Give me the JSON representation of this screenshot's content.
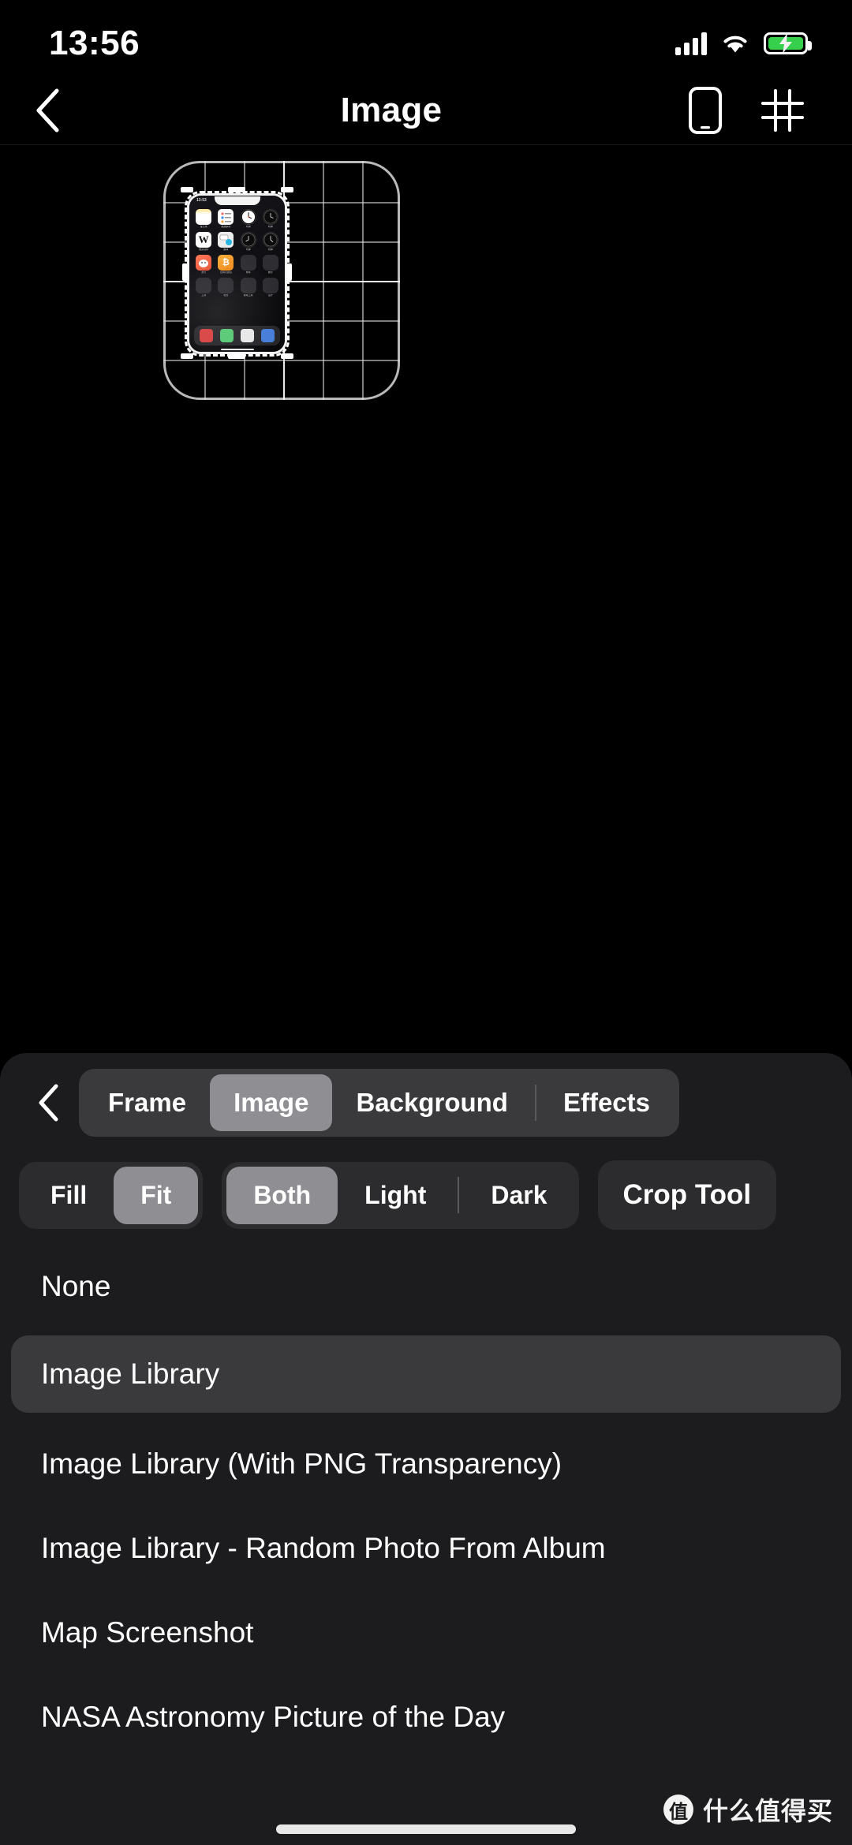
{
  "status_bar": {
    "time": "13:56",
    "cellular_icon": "cellular-signal-icon",
    "wifi_icon": "wifi-icon",
    "battery_icon": "battery-charging-icon",
    "battery_color": "#36d04c"
  },
  "nav_bar": {
    "back_icon": "chevron-left-icon",
    "title": "Image",
    "device_icon": "phone-device-icon",
    "grid_icon": "grid-hash-icon"
  },
  "preview": {
    "frame_label": "device-frame-preview",
    "grid_overlay": true,
    "inner_screenshot_time": "13:53",
    "inner_apps": [
      {
        "label": "备忘录",
        "icon": "notes-icon"
      },
      {
        "label": "提醒事项",
        "icon": "reminders-icon"
      },
      {
        "label": "时钟",
        "icon": "clock-widget-icon"
      },
      {
        "label": "时钟",
        "icon": "clock-widget-icon"
      },
      {
        "label": "维基百科",
        "icon": "wikipedia-icon"
      },
      {
        "label": "翻译",
        "icon": "messages-icon"
      },
      {
        "label": "时钟",
        "icon": "clock-widget-icon"
      },
      {
        "label": "时钟",
        "icon": "clock-widget-icon"
      },
      {
        "label": "支付",
        "icon": "alipay-icon"
      },
      {
        "label": "比特币钱包",
        "icon": "bitcoin-icon"
      },
      {
        "label": "效率",
        "icon": "folder-icon"
      },
      {
        "label": "娱乐",
        "icon": "folder-icon"
      },
      {
        "label": "工具",
        "icon": "folder-icon"
      },
      {
        "label": "社交",
        "icon": "folder-icon"
      },
      {
        "label": "游戏工具",
        "icon": "folder-icon"
      },
      {
        "label": "设计",
        "icon": "folder-icon"
      }
    ]
  },
  "sheet": {
    "back_icon": "chevron-left-icon",
    "tabs": [
      {
        "label": "Frame",
        "active": false
      },
      {
        "label": "Image",
        "active": true
      },
      {
        "label": "Background",
        "active": false
      },
      {
        "label": "Effects",
        "active": false
      }
    ],
    "fit_segment": [
      {
        "label": "Fill",
        "active": false
      },
      {
        "label": "Fit",
        "active": true
      }
    ],
    "appearance_segment": [
      {
        "label": "Both",
        "active": true
      },
      {
        "label": "Light",
        "active": false
      },
      {
        "label": "Dark",
        "active": false
      }
    ],
    "crop_button": "Crop Tool",
    "options": [
      {
        "label": "None",
        "selected": false
      },
      {
        "label": "Image Library",
        "selected": true
      },
      {
        "label": "Image Library (With PNG Transparency)",
        "selected": false
      },
      {
        "label": "Image Library - Random Photo From Album",
        "selected": false
      },
      {
        "label": "Map Screenshot",
        "selected": false
      },
      {
        "label": "NASA Astronomy Picture of the Day",
        "selected": false
      }
    ]
  },
  "watermark": {
    "badge": "值",
    "text": "什么值得买"
  },
  "theme": {
    "background": "#000000",
    "sheet_background": "#1c1c1e",
    "control_background": "#2c2c2e",
    "segment_background": "#3a3a3c",
    "active_segment": "#8e8e93",
    "text_primary": "#ffffff"
  }
}
